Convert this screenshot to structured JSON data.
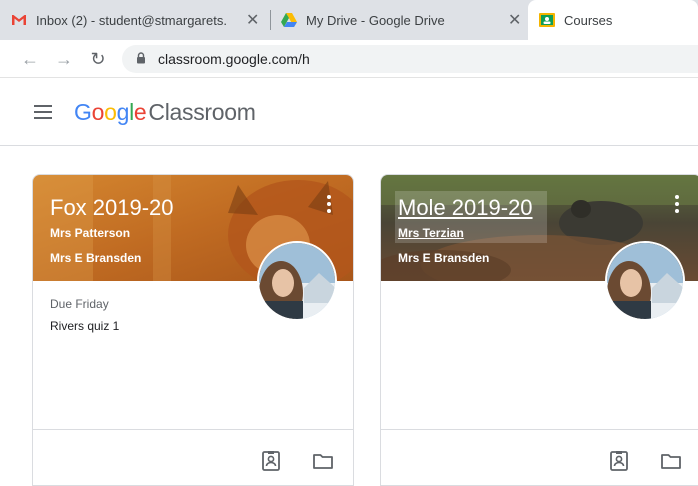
{
  "browser": {
    "tabs": [
      {
        "title": "Inbox (2) - student@stmargarets.",
        "icon": "gmail-icon",
        "active": false
      },
      {
        "title": "My Drive - Google Drive",
        "icon": "drive-icon",
        "active": false
      },
      {
        "title": "Courses",
        "icon": "classroom-icon",
        "active": true
      }
    ],
    "tab_close_glyph": "✕",
    "url": "classroom.google.com/h"
  },
  "app": {
    "logo_google": [
      "G",
      "o",
      "o",
      "g",
      "l",
      "e"
    ],
    "logo_product": "Classroom"
  },
  "courses": [
    {
      "title": "Fox 2019-20",
      "section": "Mrs Patterson",
      "teacher": "Mrs E Bransden",
      "due_label": "Due Friday",
      "due_item": "Rivers quiz 1",
      "theme_color": "#c7772a"
    },
    {
      "title": "Mole 2019-20",
      "section": "Mrs Terzian",
      "teacher": "Mrs E Bransden",
      "theme_color": "#4c4a3c"
    }
  ],
  "colors": {
    "google_blue": "#4285f4",
    "google_red": "#ea4335",
    "google_yellow": "#fbbc05",
    "google_green": "#34a853"
  }
}
